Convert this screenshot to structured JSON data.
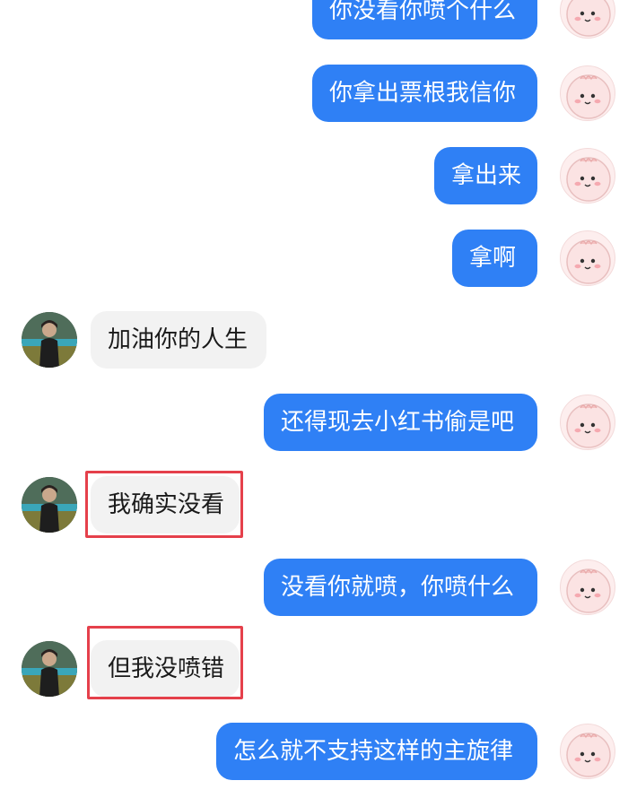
{
  "messages": [
    {
      "from": "me",
      "text": "你没看你喷个什么"
    },
    {
      "from": "me",
      "text": "你拿出票根我信你"
    },
    {
      "from": "me",
      "text": "拿出来"
    },
    {
      "from": "me",
      "text": "拿啊"
    },
    {
      "from": "them",
      "text": "加油你的人生"
    },
    {
      "from": "me",
      "text": "还得现去小红书偷是吧"
    },
    {
      "from": "them",
      "text": "我确实没看",
      "highlighted": true
    },
    {
      "from": "me",
      "text": "没看你就喷，你喷什么"
    },
    {
      "from": "them",
      "text": "但我没喷错",
      "highlighted": true
    },
    {
      "from": "me",
      "text": "怎么就不支持这样的主旋律"
    }
  ],
  "colors": {
    "my_bubble": "#2f80f5",
    "their_bubble": "#f2f2f2",
    "highlight_box": "#e5404b"
  },
  "icons": {
    "my_avatar": "pink-dinosaur-avatar-icon",
    "their_avatar": "person-photo-avatar-icon"
  }
}
